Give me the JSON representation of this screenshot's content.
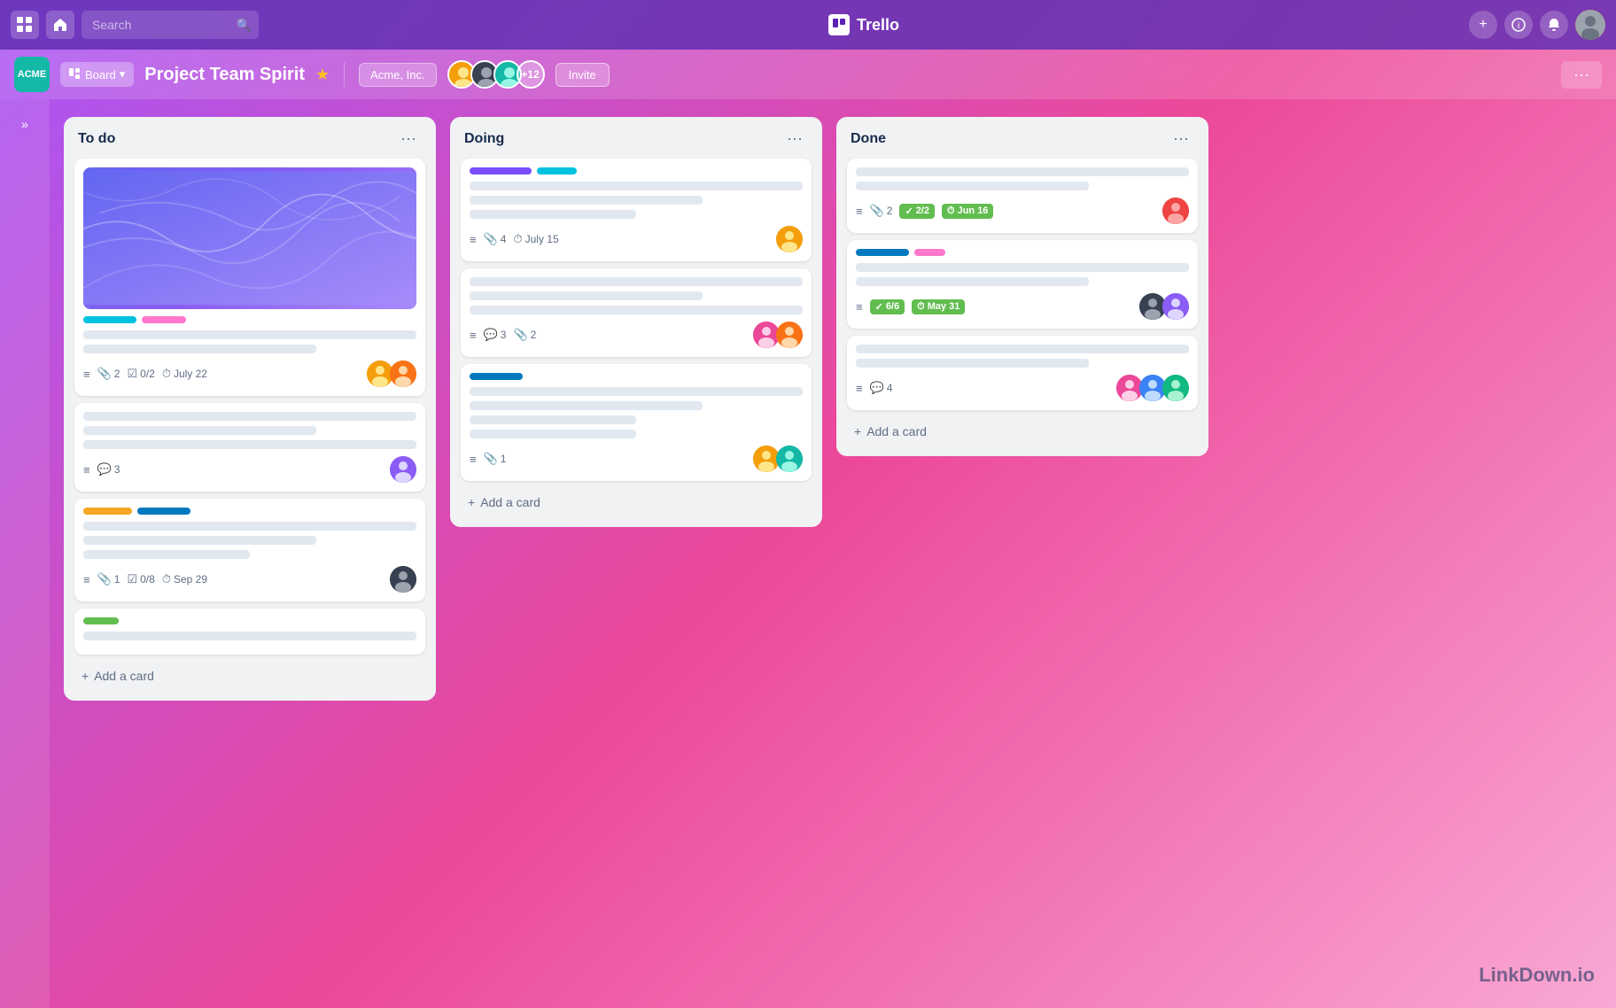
{
  "app": {
    "name": "Trello",
    "logo_text": "T"
  },
  "nav": {
    "search_placeholder": "Search",
    "grid_icon": "⊞",
    "home_icon": "⌂",
    "search_icon": "🔍",
    "add_icon": "+",
    "info_icon": "ℹ",
    "bell_icon": "🔔",
    "more_icon": "···"
  },
  "board_header": {
    "workspace_logo": "ACME",
    "view_label": "Board",
    "board_title": "Project Team Spirit",
    "star_icon": "★",
    "workspace_tag": "Acme, Inc.",
    "member_count_label": "+12",
    "invite_label": "Invite",
    "more_dots": "···"
  },
  "sidebar": {
    "collapse_icon": "»"
  },
  "lists": [
    {
      "id": "todo",
      "title": "To do",
      "cards": [
        {
          "id": "todo-1",
          "has_cover": true,
          "labels": [
            "cyan",
            "pink"
          ],
          "lines": [
            "full",
            "med",
            "short"
          ],
          "meta": {
            "has_description": true,
            "attachments": "2",
            "checklist": "0/2",
            "date": "July 22"
          },
          "avatars": [
            "yellow",
            "orange"
          ]
        },
        {
          "id": "todo-2",
          "has_cover": false,
          "labels": [],
          "lines": [
            "full",
            "med",
            "full"
          ],
          "meta": {
            "has_description": true,
            "comments": "3"
          },
          "avatars": [
            "purple"
          ]
        },
        {
          "id": "todo-3",
          "has_cover": false,
          "labels": [
            "yellow",
            "blue"
          ],
          "lines": [
            "full",
            "med",
            "short"
          ],
          "meta": {
            "has_description": true,
            "attachments": "1",
            "checklist": "0/8",
            "date": "Sep 29"
          },
          "avatars": [
            "dark"
          ]
        },
        {
          "id": "todo-4",
          "has_cover": false,
          "labels": [
            "green"
          ],
          "lines": [
            "full"
          ],
          "meta": {},
          "avatars": []
        }
      ],
      "add_label": "Add a card"
    },
    {
      "id": "doing",
      "title": "Doing",
      "cards": [
        {
          "id": "doing-1",
          "has_cover": false,
          "labels": [
            "purple",
            "teal"
          ],
          "lines": [
            "full",
            "med",
            "short"
          ],
          "meta": {
            "has_description": true,
            "attachments": "4",
            "date": "July 15"
          },
          "avatars": [
            "yellow"
          ]
        },
        {
          "id": "doing-2",
          "has_cover": false,
          "labels": [],
          "lines": [
            "full",
            "med",
            "full"
          ],
          "meta": {
            "has_description": true,
            "comments": "3",
            "attachments": "2"
          },
          "avatars": [
            "pink",
            "orange"
          ]
        },
        {
          "id": "doing-3",
          "has_cover": false,
          "labels": [
            "blue"
          ],
          "lines": [
            "full",
            "med",
            "short",
            "short"
          ],
          "meta": {
            "has_description": true,
            "attachments": "1"
          },
          "avatars": [
            "yellow",
            "teal"
          ]
        }
      ],
      "add_label": "Add a card"
    },
    {
      "id": "done",
      "title": "Done",
      "cards": [
        {
          "id": "done-1",
          "has_cover": false,
          "labels": [],
          "lines": [
            "full",
            "med"
          ],
          "meta": {
            "has_description": true,
            "attachments": "2",
            "checklist_done": "2/2",
            "date_done": "Jun 16"
          },
          "avatars": [
            "red"
          ]
        },
        {
          "id": "done-2",
          "has_cover": false,
          "labels": [
            "blue",
            "hotpink"
          ],
          "lines": [
            "full",
            "med"
          ],
          "meta": {
            "has_description": true,
            "checklist_done": "6/6",
            "date_done": "May 31"
          },
          "avatars": [
            "dark",
            "purple"
          ]
        },
        {
          "id": "done-3",
          "has_cover": false,
          "labels": [],
          "lines": [
            "full",
            "med"
          ],
          "meta": {
            "has_description": true,
            "comments": "4"
          },
          "avatars": [
            "pink",
            "blue",
            "green"
          ]
        }
      ],
      "add_label": "Add a card"
    }
  ],
  "watermark": "LinkDown.io"
}
